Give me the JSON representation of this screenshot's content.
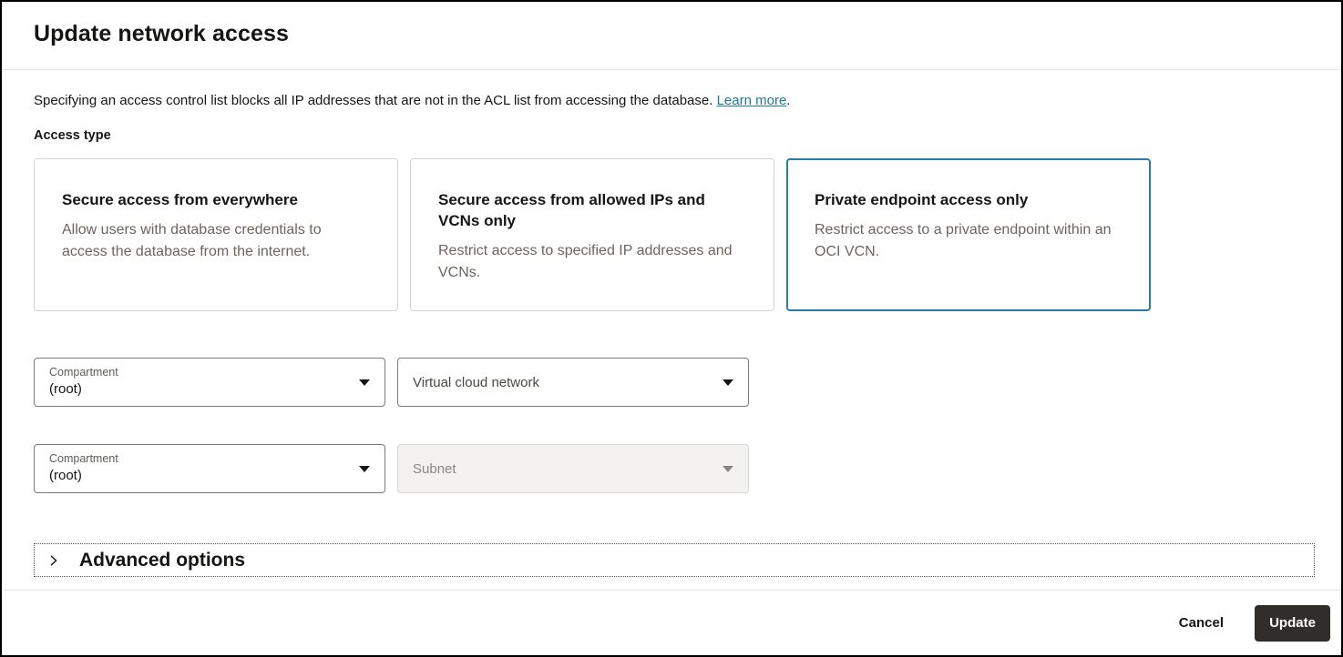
{
  "dialog": {
    "title": "Update network access",
    "description": "Specifying an access control list blocks all IP addresses that are not in the ACL list from accessing the database.",
    "learn_more_label": "Learn more",
    "learn_more_suffix": ".",
    "access_type_label": "Access type"
  },
  "access_cards": [
    {
      "title": "Secure access from everywhere",
      "description": "Allow users with database credentials to access the database from the internet.",
      "selected": false
    },
    {
      "title": "Secure access from allowed IPs and VCNs only",
      "description": "Restrict access to specified IP addresses and VCNs.",
      "selected": false
    },
    {
      "title": "Private endpoint access only",
      "description": "Restrict access to a private endpoint within an OCI VCN.",
      "selected": true
    }
  ],
  "form": {
    "vcn_compartment": {
      "label": "Compartment",
      "value": "(root)"
    },
    "vcn_select": {
      "placeholder": "Virtual cloud network"
    },
    "subnet_compartment": {
      "label": "Compartment",
      "value": "(root)"
    },
    "subnet_select": {
      "placeholder": "Subnet",
      "disabled": true
    }
  },
  "advanced_options": {
    "label": "Advanced options",
    "icon": "chevron-right-icon",
    "expanded": false
  },
  "footer": {
    "cancel_label": "Cancel",
    "update_label": "Update"
  },
  "colors": {
    "selected_card_border": "#2a7c9e",
    "link": "#1d7a9c",
    "primary_button_bg": "#312d2a",
    "dialog_border": "#000000",
    "disabled_field_bg": "#f4f2f1"
  }
}
